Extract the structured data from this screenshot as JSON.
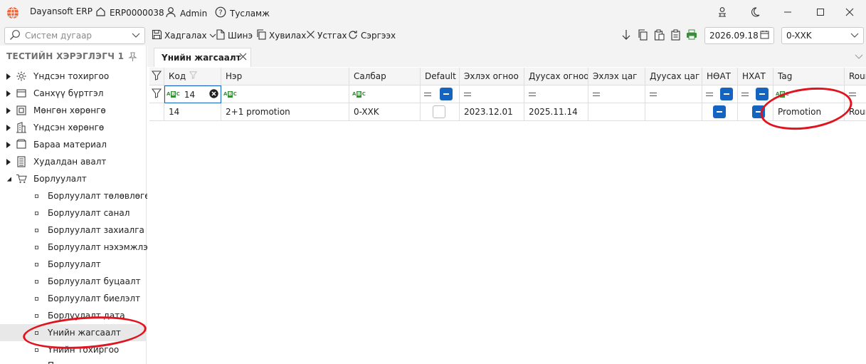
{
  "titlebar": {
    "app_name": "Dayansoft ERP",
    "code": "ERP0000038",
    "user": "Admin",
    "help": "Тусламж"
  },
  "toolbar": {
    "search_placeholder": "Систем дугаар",
    "save": "Хадгалах",
    "new": "Шинэ",
    "copy": "Хувилах",
    "delete": "Устгах",
    "refresh": "Сэргээх",
    "date": "2026.09.18",
    "branch": "0-XXK"
  },
  "sidebar": {
    "header": "ТЕСТИЙН ХЭРЭГЛЭГЧ 1",
    "items": [
      {
        "label": "Үндсэн тохиргоо",
        "icon": "gear-icon"
      },
      {
        "label": "Санхүү бүртгэл",
        "icon": "ledger-icon"
      },
      {
        "label": "Мөнгөн хөрөнгө",
        "icon": "cash-icon"
      },
      {
        "label": "Үндсэн хөрөнгө",
        "icon": "building-icon"
      },
      {
        "label": "Бараа материал",
        "icon": "box-icon"
      },
      {
        "label": "Худалдан авалт",
        "icon": "register-icon"
      },
      {
        "label": "Борлуулалт",
        "icon": "cart-icon"
      }
    ],
    "children": [
      "Борлуулалт төлөвлөгөө",
      "Борлуулалт санал",
      "Борлуулалт захиалга",
      "Борлуулалт нэхэмжлэх",
      "Борлуулалт",
      "Борлуулалт буцаалт",
      "Борлуулалт биелэлт",
      "Борлуулалт дата",
      "Үнийн жагсаалт",
      "Үнийн тохиргоо",
      "П"
    ],
    "selected": "Үнийн жагсаалт"
  },
  "tab": {
    "label": "Үнийн жагсаалт"
  },
  "grid": {
    "columns": [
      "Код",
      "Нэр",
      "Салбар",
      "Default",
      "Эхлэх огноо",
      "Дуусах огноо",
      "Эхлэх цаг",
      "Дуусах цаг",
      "НӨАТ",
      "НХАТ",
      "Tag",
      "Round"
    ],
    "filter_code": "14",
    "rows": [
      {
        "code": "14",
        "name": "2+1 promotion",
        "branch": "0-XXK",
        "start_date": "2023.12.01",
        "end_date": "2025.11.14",
        "tag": "Promotion",
        "round": "Round"
      }
    ]
  },
  "colors": {
    "accent": "#1565c0",
    "annotation": "#e0141e",
    "selected_row": "#e8e8e8"
  }
}
